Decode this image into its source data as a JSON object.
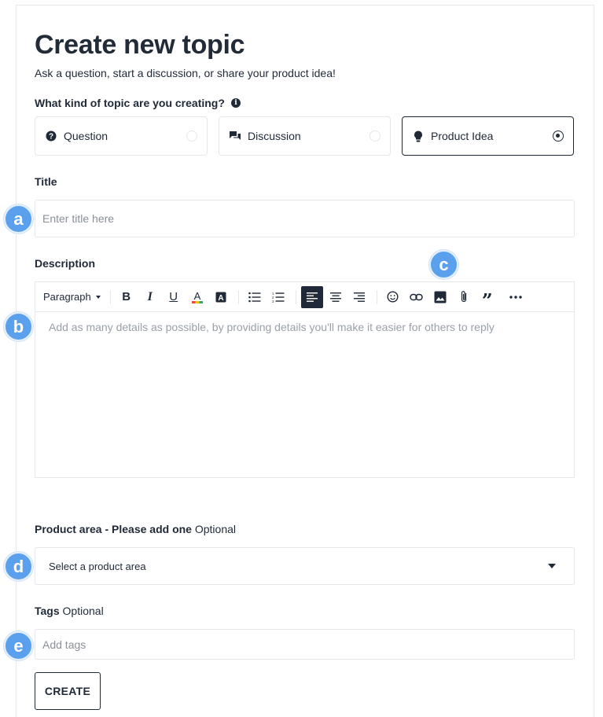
{
  "header": {
    "title": "Create new topic",
    "subtitle": "Ask a question, start a discussion, or share your product idea!"
  },
  "topic_type": {
    "label": "What kind of topic are you creating?",
    "options": [
      {
        "label": "Question",
        "icon": "question-circle-icon",
        "selected": false
      },
      {
        "label": "Discussion",
        "icon": "chat-bubbles-icon",
        "selected": false
      },
      {
        "label": "Product Idea",
        "icon": "lightbulb-icon",
        "selected": true
      }
    ]
  },
  "title_field": {
    "label": "Title",
    "placeholder": "Enter title here",
    "value": ""
  },
  "description": {
    "label": "Description",
    "paragraph_select": "Paragraph",
    "placeholder": "Add as many details as possible, by providing details you'll make it easier for others to reply",
    "toolbar": [
      "bold-icon",
      "italic-icon",
      "underline-icon",
      "text-color-icon",
      "highlight-icon",
      "bullet-list-icon",
      "numbered-list-icon",
      "align-left-icon",
      "align-center-icon",
      "align-right-icon",
      "emoji-icon",
      "link-icon",
      "image-icon",
      "attachment-icon",
      "quote-icon",
      "more-icon"
    ],
    "active_tool": "align-left-icon"
  },
  "product_area": {
    "label": "Product area - Please add one",
    "optional": "Optional",
    "placeholder": "Select a product area"
  },
  "tags": {
    "label": "Tags",
    "optional": "Optional",
    "placeholder": "Add tags"
  },
  "create_button": "CREATE",
  "markers": [
    "a",
    "b",
    "c",
    "d",
    "e"
  ],
  "colors": {
    "text": "#1f2937",
    "border": "#e5e7eb",
    "marker": "#5aa0ec"
  }
}
